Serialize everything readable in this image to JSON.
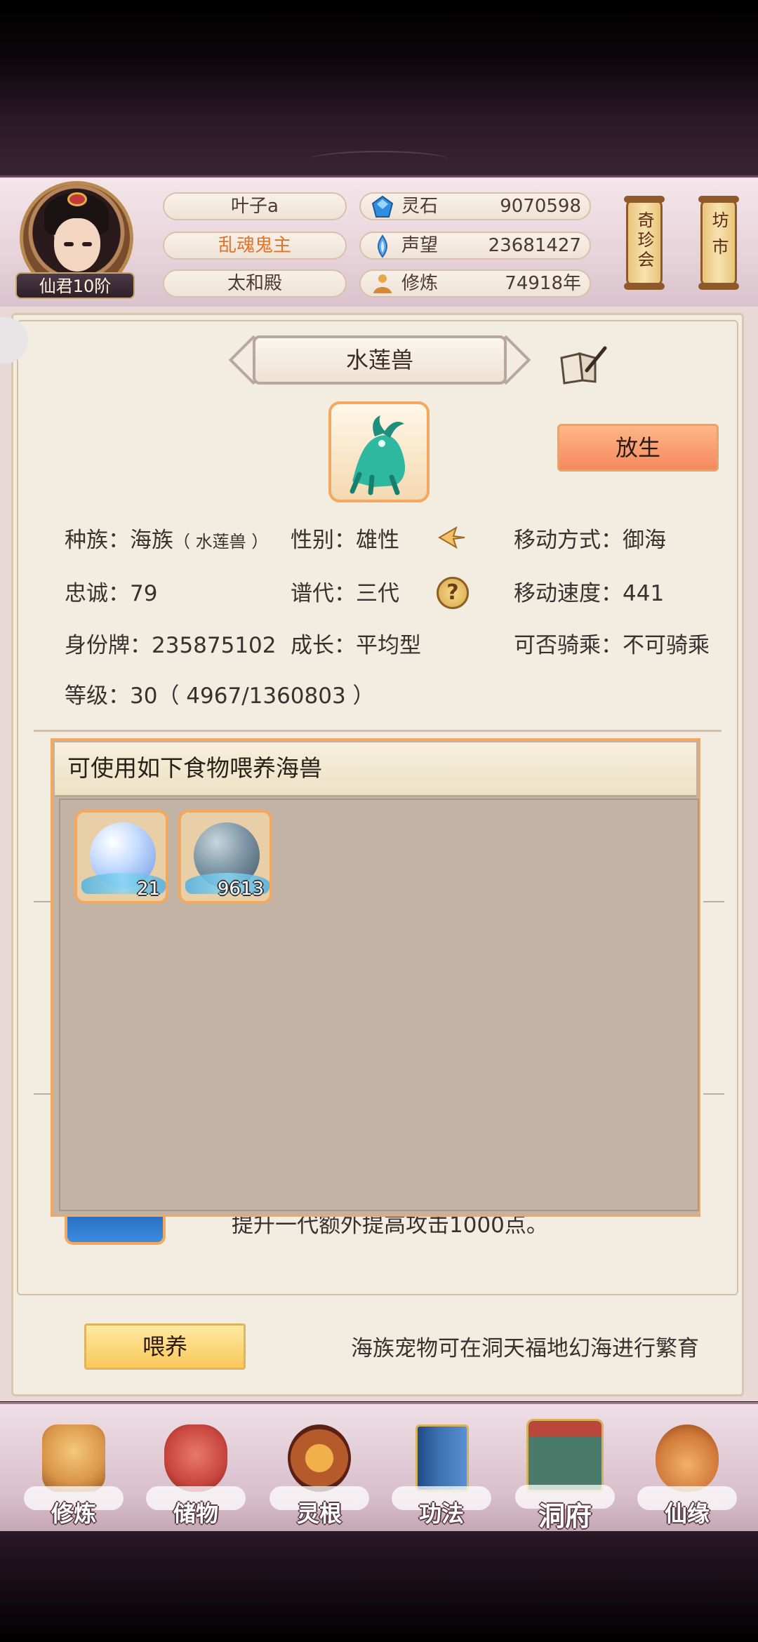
{
  "header": {
    "rank_label": "仙君10阶",
    "player_name": "叶子a",
    "title_name": "乱魂鬼主",
    "sect_name": "太和殿",
    "stats": [
      {
        "icon": "spirit-stone-icon",
        "label": "灵石",
        "value": "9070598"
      },
      {
        "icon": "reputation-icon",
        "label": "声望",
        "value": "23681427"
      },
      {
        "icon": "cultivation-icon",
        "label": "修炼",
        "value": "74918年"
      }
    ],
    "shortcuts": [
      {
        "label": "奇珍会"
      },
      {
        "label": "坊市"
      }
    ]
  },
  "pet": {
    "title": "水莲兽",
    "release_label": "放生",
    "race_label": "种族：",
    "race_value": "海族",
    "race_sub": "（ 水莲兽 ）",
    "gender": "性别：雄性",
    "movement": "移动方式：御海",
    "loyalty": "忠诚：79",
    "generation": "谱代：三代",
    "speed": "移动速度：441",
    "id_tag": "身份牌：235875102",
    "growth": "成长：平均型",
    "rideable": "可否骑乘：不可骑乘",
    "level": "等级：30（ 4967/1360803 ）"
  },
  "feed_popup": {
    "title": "可使用如下食物喂养海兽",
    "items": [
      {
        "icon": "sea-orb-icon",
        "count": "21",
        "color": "#b8d4ff"
      },
      {
        "icon": "dark-sea-orb-icon",
        "count": "9613",
        "color": "#6f8aa0"
      }
    ]
  },
  "background_text": "提升一代额外提高攻击1000点。",
  "footer": {
    "feed_label": "喂养",
    "hint": "海族宠物可在洞天福地幻海进行繁育"
  },
  "nav": [
    {
      "icon": "cultivate-icon",
      "label": "修炼",
      "color": "#d9964a"
    },
    {
      "icon": "storage-bag-icon",
      "label": "储物",
      "color": "#c8463e"
    },
    {
      "icon": "spirit-root-icon",
      "label": "灵根",
      "color": "#b55a2a"
    },
    {
      "icon": "technique-book-icon",
      "label": "功法",
      "color": "#3a6fb0"
    },
    {
      "icon": "cave-mansion-icon",
      "label": "洞府",
      "color": "#4a7a6a"
    },
    {
      "icon": "fate-gourd-icon",
      "label": "仙缘",
      "color": "#d07a3a"
    }
  ]
}
